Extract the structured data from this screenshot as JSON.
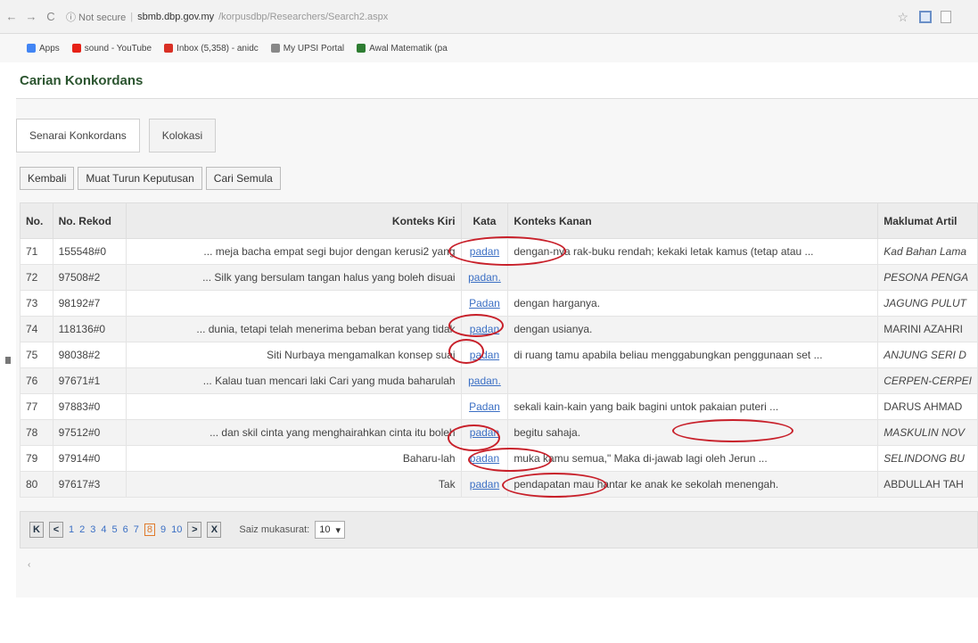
{
  "browser": {
    "back": "←",
    "forward": "→",
    "reload": "C",
    "secure_label": "ⓘ Not secure",
    "host": "sbmb.dbp.gov.my",
    "path": "/korpusdbp/Researchers/Search2.aspx",
    "bookmarks": [
      {
        "label": "Apps",
        "color": "#4285f4"
      },
      {
        "label": "sound - YouTube",
        "color": "#e62117"
      },
      {
        "label": "Inbox (5,358) - anidc",
        "color": "#d93025"
      },
      {
        "label": "My UPSI Portal",
        "color": "#888888"
      },
      {
        "label": "Awal Matematik (pa",
        "color": "#2e7d32"
      }
    ]
  },
  "page": {
    "title": "Carian Konkordans",
    "tabs": [
      {
        "label": "Senarai Konkordans",
        "active": true
      },
      {
        "label": "Kolokasi",
        "active": false
      }
    ],
    "toolbar": {
      "back": "Kembali",
      "download": "Muat Turun Keputusan",
      "search_again": "Cari Semula"
    }
  },
  "table": {
    "headers": {
      "no": "No.",
      "rekod": "No. Rekod",
      "kiri": "Konteks Kiri",
      "kata": "Kata",
      "kanan": "Konteks Kanan",
      "maklumat": "Maklumat Artil"
    },
    "rows": [
      {
        "no": "71",
        "rekod": "155548#0",
        "kiri": "... meja bacha empat segi bujor dengan kerusi2 yang",
        "kata": "padan",
        "kanan": "dengan-nya rak-buku rendah; kekaki letak kamus (tetap atau ...",
        "maklumat": "Kad Bahan Lama",
        "italic": true
      },
      {
        "no": "72",
        "rekod": "97508#2",
        "kiri": "... Silk yang bersulam tangan halus yang boleh disuai",
        "kata": "padan.",
        "kanan": "",
        "maklumat": "PESONA PENGA",
        "italic": true
      },
      {
        "no": "73",
        "rekod": "98192#7",
        "kiri": "",
        "kata": "Padan",
        "kanan": "dengan harganya.",
        "maklumat": "JAGUNG PULUT",
        "italic": true
      },
      {
        "no": "74",
        "rekod": "118136#0",
        "kiri": "... dunia, tetapi telah menerima beban berat yang tidak",
        "kata": "padan",
        "kanan": "dengan usianya.",
        "maklumat": "MARINI AZAHRI",
        "italic": false
      },
      {
        "no": "75",
        "rekod": "98038#2",
        "kiri": "Siti Nurbaya mengamalkan konsep suai",
        "kata": "padan",
        "kanan": "di ruang tamu apabila beliau menggabungkan penggunaan set ...",
        "maklumat": "ANJUNG SERI D",
        "italic": true
      },
      {
        "no": "76",
        "rekod": "97671#1",
        "kiri": "... Kalau tuan mencari laki Cari yang muda baharulah",
        "kata": "padan.",
        "kanan": "",
        "maklumat": "CERPEN-CERPEI",
        "italic": true
      },
      {
        "no": "77",
        "rekod": "97883#0",
        "kiri": "",
        "kata": "Padan",
        "kanan": "sekali kain-kain yang baik bagini untok pakaian puteri ...",
        "maklumat": "DARUS AHMAD",
        "italic": false
      },
      {
        "no": "78",
        "rekod": "97512#0",
        "kiri": "... dan skil cinta yang menghairahkan cinta itu boleh",
        "kata": "padan",
        "kanan": "begitu sahaja.",
        "maklumat": "MASKULIN NOV",
        "italic": true
      },
      {
        "no": "79",
        "rekod": "97914#0",
        "kiri": "Baharu-lah",
        "kata": "padan",
        "kanan": "muka kamu semua,\" Maka di-jawab lagi oleh Jerun ...",
        "maklumat": "SELINDONG BU",
        "italic": true
      },
      {
        "no": "80",
        "rekod": "97617#3",
        "kiri": "Tak",
        "kata": "padan",
        "kanan": "pendapatan mau hantar ke anak ke sekolah menengah.",
        "maklumat": "ABDULLAH TAH",
        "italic": false
      }
    ]
  },
  "pager": {
    "first": "K",
    "prev": "<",
    "pages": [
      "1",
      "2",
      "3",
      "4",
      "5",
      "6",
      "7",
      "8",
      "9",
      "10"
    ],
    "current": "8",
    "next": ">",
    "last": "X",
    "size_label": "Saiz mukasurat:",
    "size_value": "10",
    "size_caret": "▾"
  },
  "footer": {
    "caret": "‹"
  },
  "colors": {
    "annotation_red": "#c8202a",
    "link_blue": "#3b6fc4",
    "title_green": "#2c5530"
  }
}
